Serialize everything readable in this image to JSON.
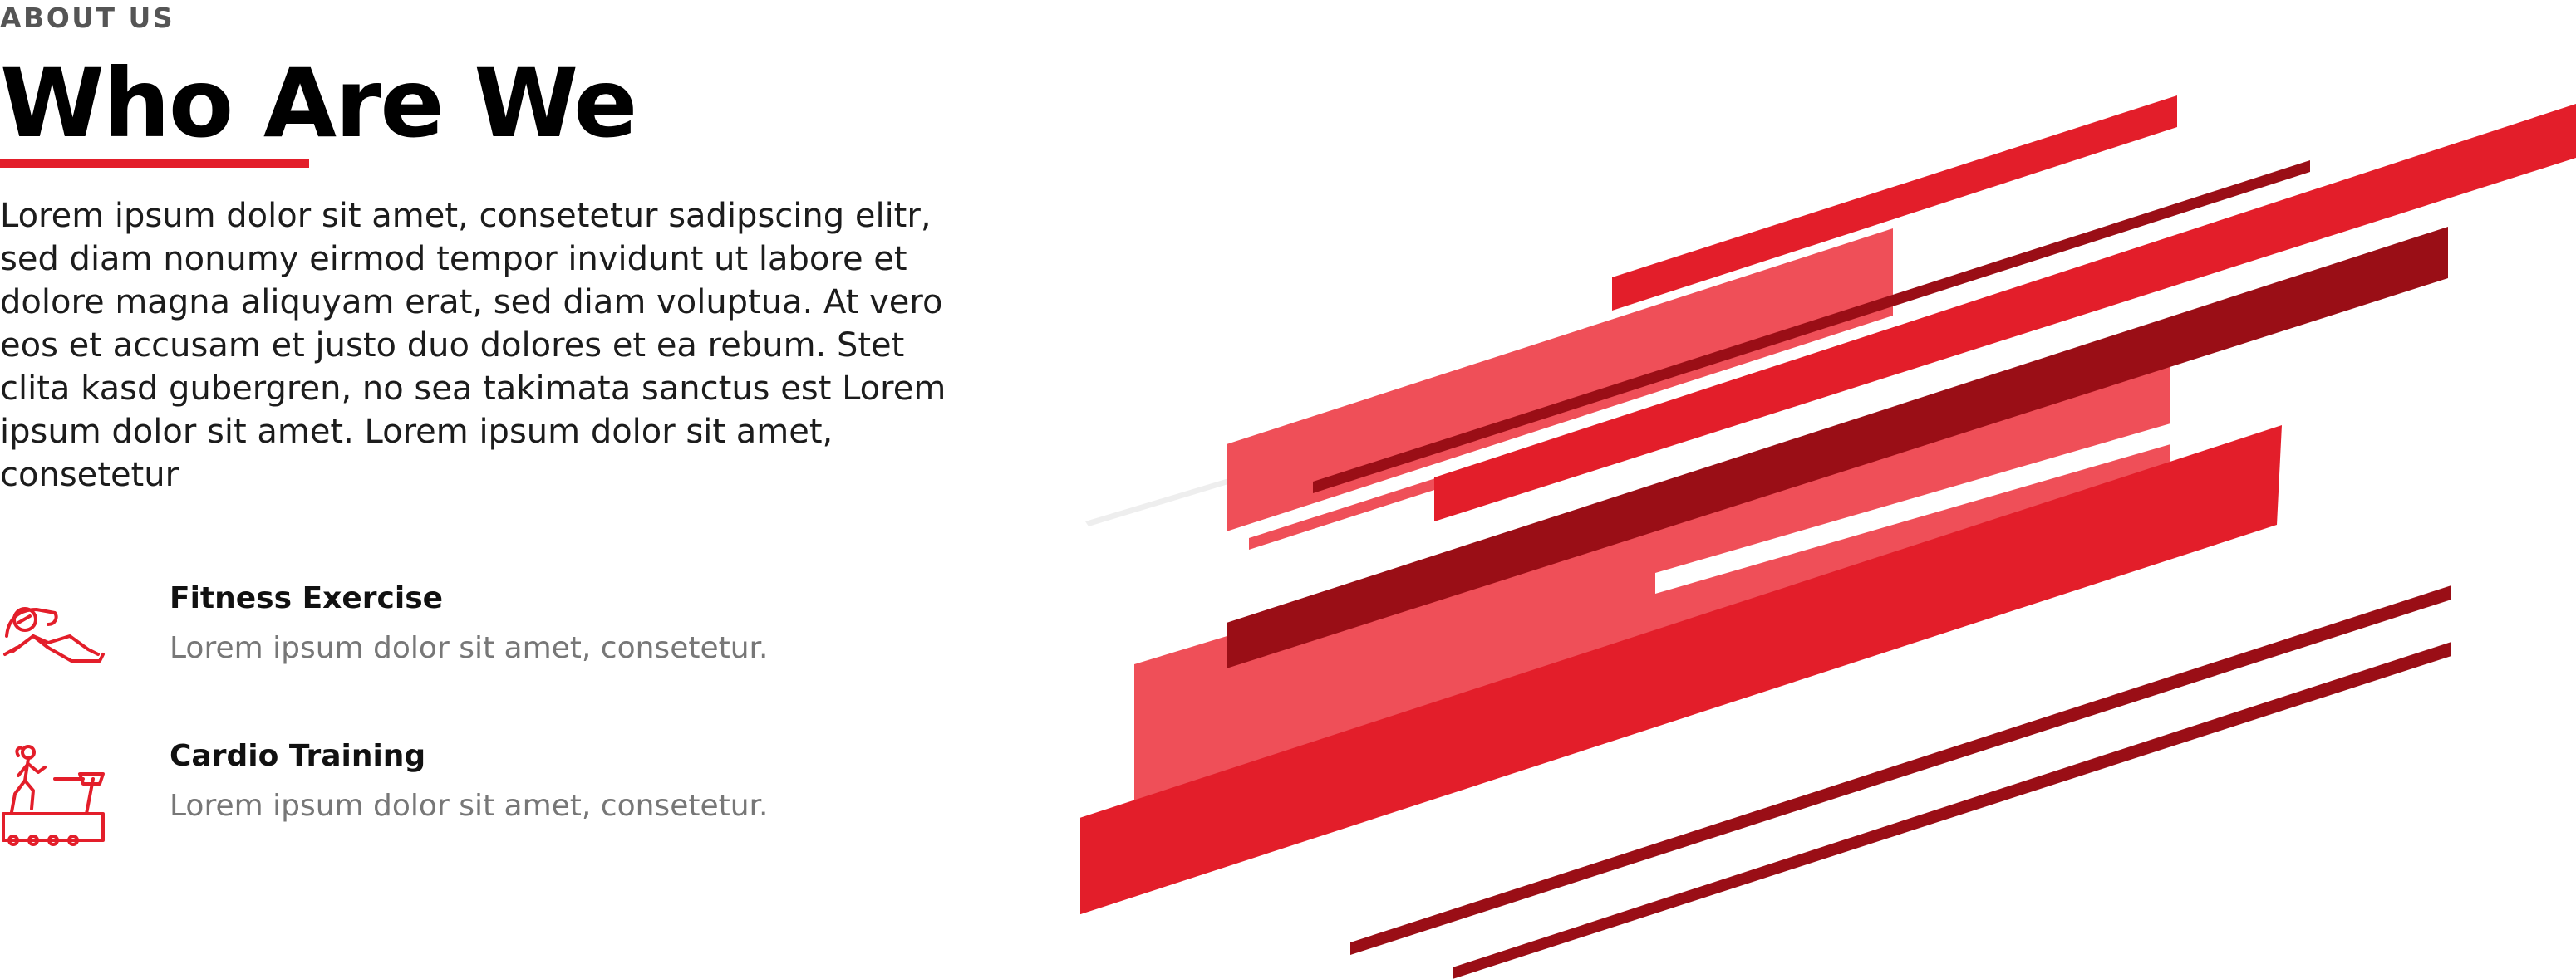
{
  "section": {
    "eyebrow": "ABOUT US",
    "title": "Who Are We",
    "body": "Lorem ipsum dolor sit amet, consetetur sadipscing elitr, sed diam nonumy eirmod tempor invidunt ut labore et dolore magna aliquyam erat, sed diam voluptua. At vero eos et accusam et justo duo dolores et ea rebum. Stet clita kasd gubergren, no sea takimata sanctus est Lorem ipsum dolor sit amet. Lorem ipsum dolor sit amet, consetetur"
  },
  "features": [
    {
      "icon": "sit-up-exercise-icon",
      "title": "Fitness Exercise",
      "description": "Lorem ipsum dolor sit amet, consetetur."
    },
    {
      "icon": "treadmill-runner-icon",
      "title": "Cardio Training",
      "description": "Lorem ipsum dolor sit amet, consetetur."
    }
  ],
  "colors": {
    "accent": "#e31e2a",
    "accent_light": "#ef4f58",
    "accent_dark": "#9a0e16",
    "title": "#000000",
    "body_text": "#1c1c1c",
    "muted_text": "#777777",
    "eyebrow": "#555555"
  }
}
